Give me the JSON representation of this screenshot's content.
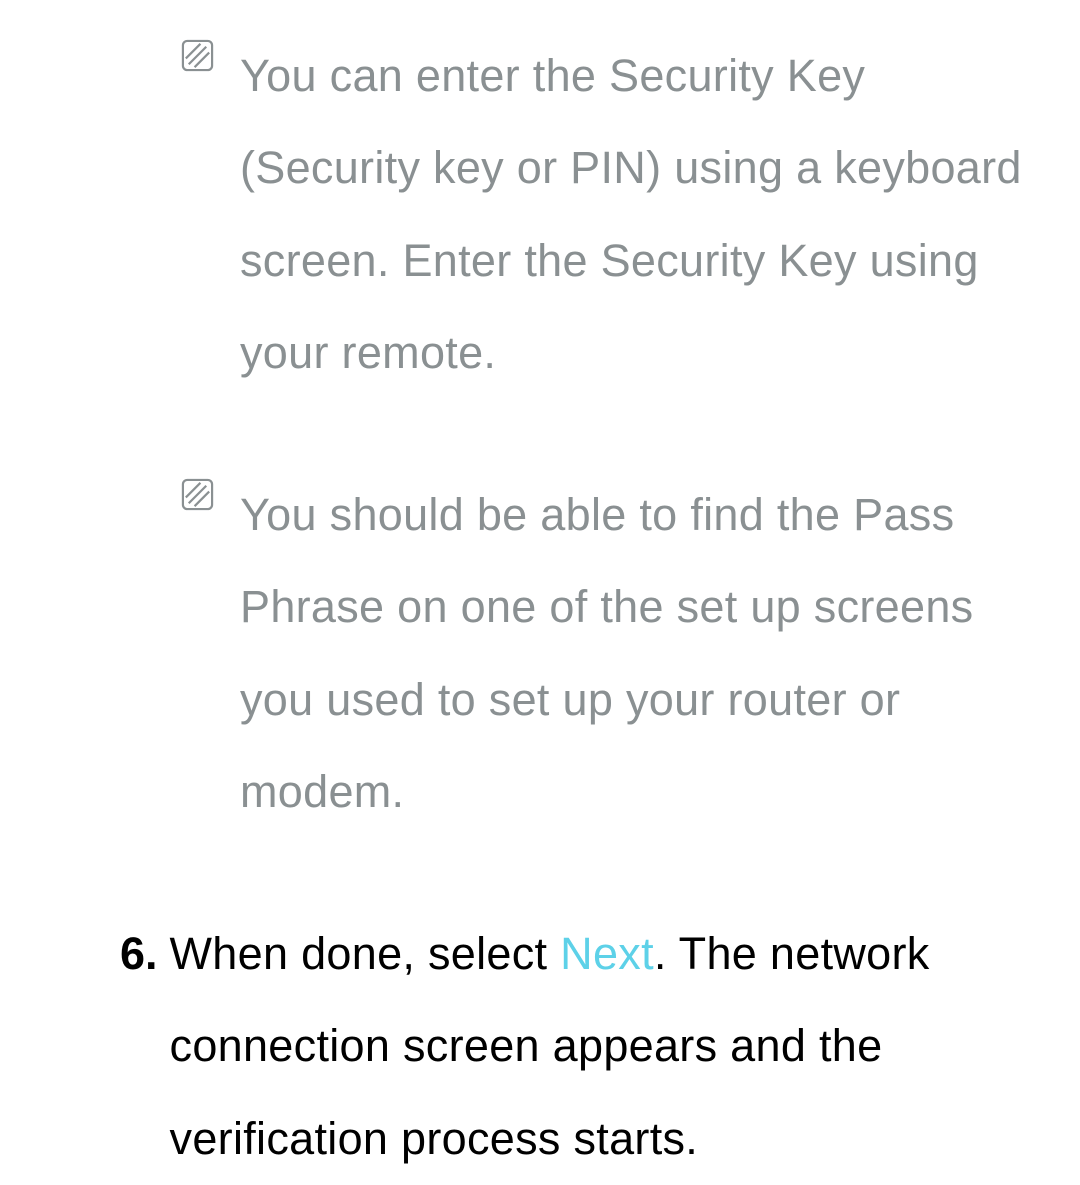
{
  "notes": [
    {
      "text": "You can enter the Security Key (Security key or PIN) using a keyboard screen. Enter the Security Key using your remote."
    },
    {
      "text": "You should be able to find the Pass Phrase on one of the set up screens you used to set up your router or modem."
    }
  ],
  "step": {
    "number": "6.",
    "prefix": "When done, select ",
    "highlight": "Next",
    "suffix": ". The network connection screen appears and the verification process starts."
  }
}
